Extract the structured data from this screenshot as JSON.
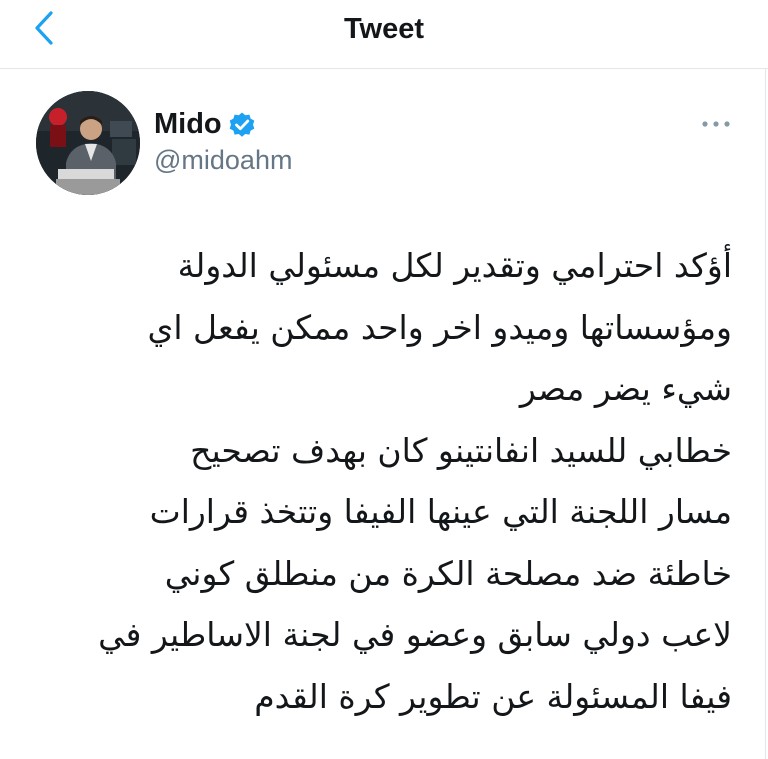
{
  "header": {
    "title": "Tweet",
    "back_icon": "chevron-left-icon",
    "accent_color": "#1da1f2"
  },
  "author": {
    "name": "Mido",
    "handle": "@midoahm",
    "verified": true,
    "verified_icon": "verified-badge-icon"
  },
  "more_icon": "ellipsis-horizontal-icon",
  "tweet": {
    "lines": [
      "أؤكد احترامي وتقدير لكل مسئولي الدولة",
      "ومؤسساتها  وميدو اخر واحد ممكن يفعل اي",
      "شيء يضر مصر",
      "خطابي للسيد انفانتينو كان بهدف تصحيح",
      "مسار اللجنة التي عينها الفيفا وتتخذ قرارات",
      "خاطئة ضد مصلحة الكرة من منطلق كوني",
      "لاعب دولي سابق وعضو في لجنة الاساطير في",
      "فيفا المسئولة عن تطوير كرة القدم"
    ]
  }
}
